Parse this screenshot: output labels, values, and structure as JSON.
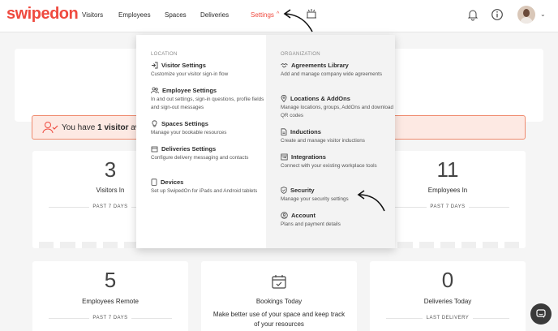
{
  "brand": {
    "logo_text": "swipedon",
    "accent": "#ef4a3f"
  },
  "nav": {
    "items": [
      "Visitors",
      "Employees",
      "Spaces",
      "Deliveries",
      "Settings"
    ],
    "active": "Settings",
    "icons": [
      "sign-in-kiosk-icon",
      "bell-icon",
      "info-icon",
      "avatar",
      "chevron-down-icon"
    ]
  },
  "alert": {
    "prefix": "You have ",
    "bold": "1 visitor",
    "suffix": " awa"
  },
  "stats": [
    {
      "number": "3",
      "label": "Visitors In",
      "sub": "PAST 7 DAYS"
    },
    {
      "number": "11",
      "label": "Employees In",
      "sub": "PAST 7 DAYS"
    },
    {
      "number": "5",
      "label": "Employees Remote",
      "sub": "PAST 7 DAYS"
    },
    {
      "label": "Bookings Today",
      "desc": "Make better use of your space and keep track of your resources"
    },
    {
      "number": "0",
      "label": "Deliveries Today",
      "sub": "LAST DELIVERY"
    }
  ],
  "dropdown": {
    "location": {
      "heading": "LOCATION",
      "items": [
        {
          "title": "Visitor Settings",
          "desc": "Customize your visitor sign-in flow"
        },
        {
          "title": "Employee Settings",
          "desc": "In and out settings, sign-in questions, profile fields and sign-out messages"
        },
        {
          "title": "Spaces Settings",
          "desc": "Manage your bookable resources"
        },
        {
          "title": "Deliveries Settings",
          "desc": "Configure delivery messaging and contacts"
        },
        {
          "title": "Devices",
          "desc": "Set up SwipedOn for iPads and Android tablets"
        }
      ]
    },
    "organization": {
      "heading": "ORGANIZATION",
      "items": [
        {
          "title": "Agreements Library",
          "desc": "Add and manage company wide agreements"
        },
        {
          "title": "Locations & AddOns",
          "desc": "Manage locations, groups, AddOns and download QR codes"
        },
        {
          "title": "Inductions",
          "desc": "Create and manage visitor inductions"
        },
        {
          "title": "Integrations",
          "desc": "Connect with your existing workplace tools"
        },
        {
          "title": "Security",
          "desc": "Manage your security settings"
        },
        {
          "title": "Account",
          "desc": "Plans and payment details"
        }
      ]
    }
  }
}
